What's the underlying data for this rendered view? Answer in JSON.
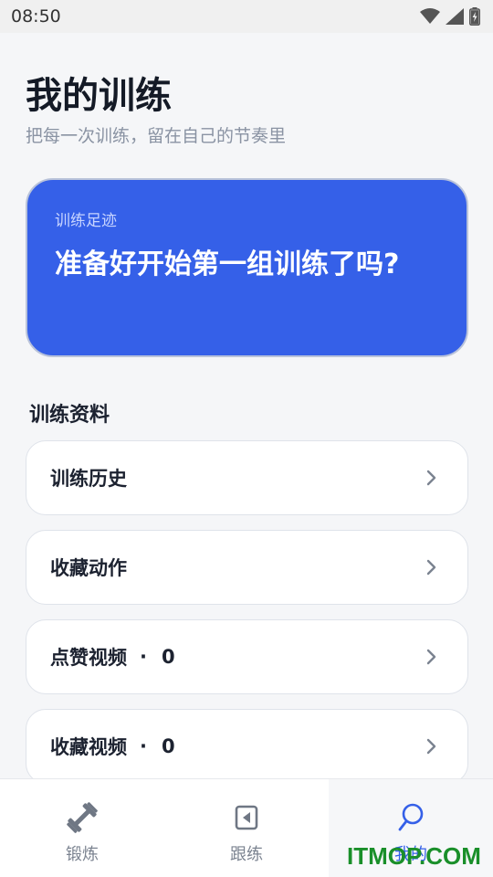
{
  "status_bar": {
    "time": "08:50"
  },
  "header": {
    "title": "我的训练",
    "subtitle": "把每一次训练，留在自己的节奏里"
  },
  "hero": {
    "label": "训练足迹",
    "text": "准备好开始第一组训练了吗?"
  },
  "section": {
    "title": "训练资料"
  },
  "list": [
    {
      "label": "训练历史",
      "count": null
    },
    {
      "label": "收藏动作",
      "count": null
    },
    {
      "label": "点赞视频",
      "count": "0"
    },
    {
      "label": "收藏视频",
      "count": "0"
    }
  ],
  "separator": "·",
  "bottom_nav": [
    {
      "label": "锻炼",
      "icon": "dumbbell-icon"
    },
    {
      "label": "跟练",
      "icon": "play-back-icon"
    },
    {
      "label": "我的",
      "icon": "profile-icon",
      "active": true
    }
  ],
  "watermark": "ITMOP.COM",
  "colors": {
    "accent": "#3560e8",
    "background": "#f5f6f8",
    "watermark": "#1a8f2a"
  }
}
